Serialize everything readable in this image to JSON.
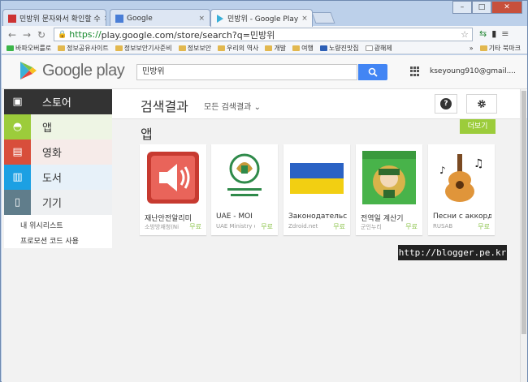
{
  "browser": {
    "tabs": [
      {
        "title": "민방위 문자와서 확인할 수",
        "close": "×"
      },
      {
        "title": "Google",
        "close": "×"
      },
      {
        "title": "민방위 - Google Play",
        "close": "×"
      }
    ],
    "window_buttons": {
      "minimize": "–",
      "maximize": "□",
      "close": "✕"
    },
    "url_secure": "https://",
    "url_rest": "play.google.com/store/search?q=민방위",
    "bookmarks": [
      "바파오버를로",
      "정보공유사이트",
      "정보보안기사준비",
      "정보보안",
      "우리의 역사",
      "개발",
      "여행",
      "노량진맛집",
      "광해제"
    ],
    "bookmarks_more": "»",
    "other_bookmarks": "기타 북마크"
  },
  "header": {
    "logo_text": "Google play",
    "search_value": "민방위",
    "account": "kseyoung910@gmail...."
  },
  "sidebar": {
    "items": [
      {
        "label": "스토어",
        "icon": "shopping-bag-icon"
      },
      {
        "label": "앱",
        "icon": "android-icon"
      },
      {
        "label": "영화",
        "icon": "film-icon"
      },
      {
        "label": "도서",
        "icon": "book-icon"
      },
      {
        "label": "기기",
        "icon": "device-icon"
      }
    ],
    "links": [
      "내 위시리스트",
      "프로모션 코드 사용"
    ]
  },
  "main": {
    "title": "검색결과",
    "filter": "모든 검색결과",
    "section": "앱",
    "more_label": "더보기",
    "help_label": "?"
  },
  "apps": [
    {
      "title": "재난안전알리미",
      "developer": "소방방재청(Ni",
      "price": "무료"
    },
    {
      "title": "UAE - MOI",
      "developer": "UAE Ministry o",
      "price": "무료"
    },
    {
      "title": "Законодательс",
      "developer": "Zdroid.net",
      "price": "무료"
    },
    {
      "title": "전역일 계산기",
      "developer": "군인누리",
      "price": "무료"
    },
    {
      "title": "Песни с аккорд",
      "developer": "RUSAB",
      "price": "무료"
    }
  ],
  "watermark": "http://blogger.pe.kr",
  "colors": {
    "accent_green": "#9ccc3b",
    "search_blue": "#4285f4",
    "movies_red": "#d84e3b",
    "books_blue": "#1ca0e3"
  }
}
